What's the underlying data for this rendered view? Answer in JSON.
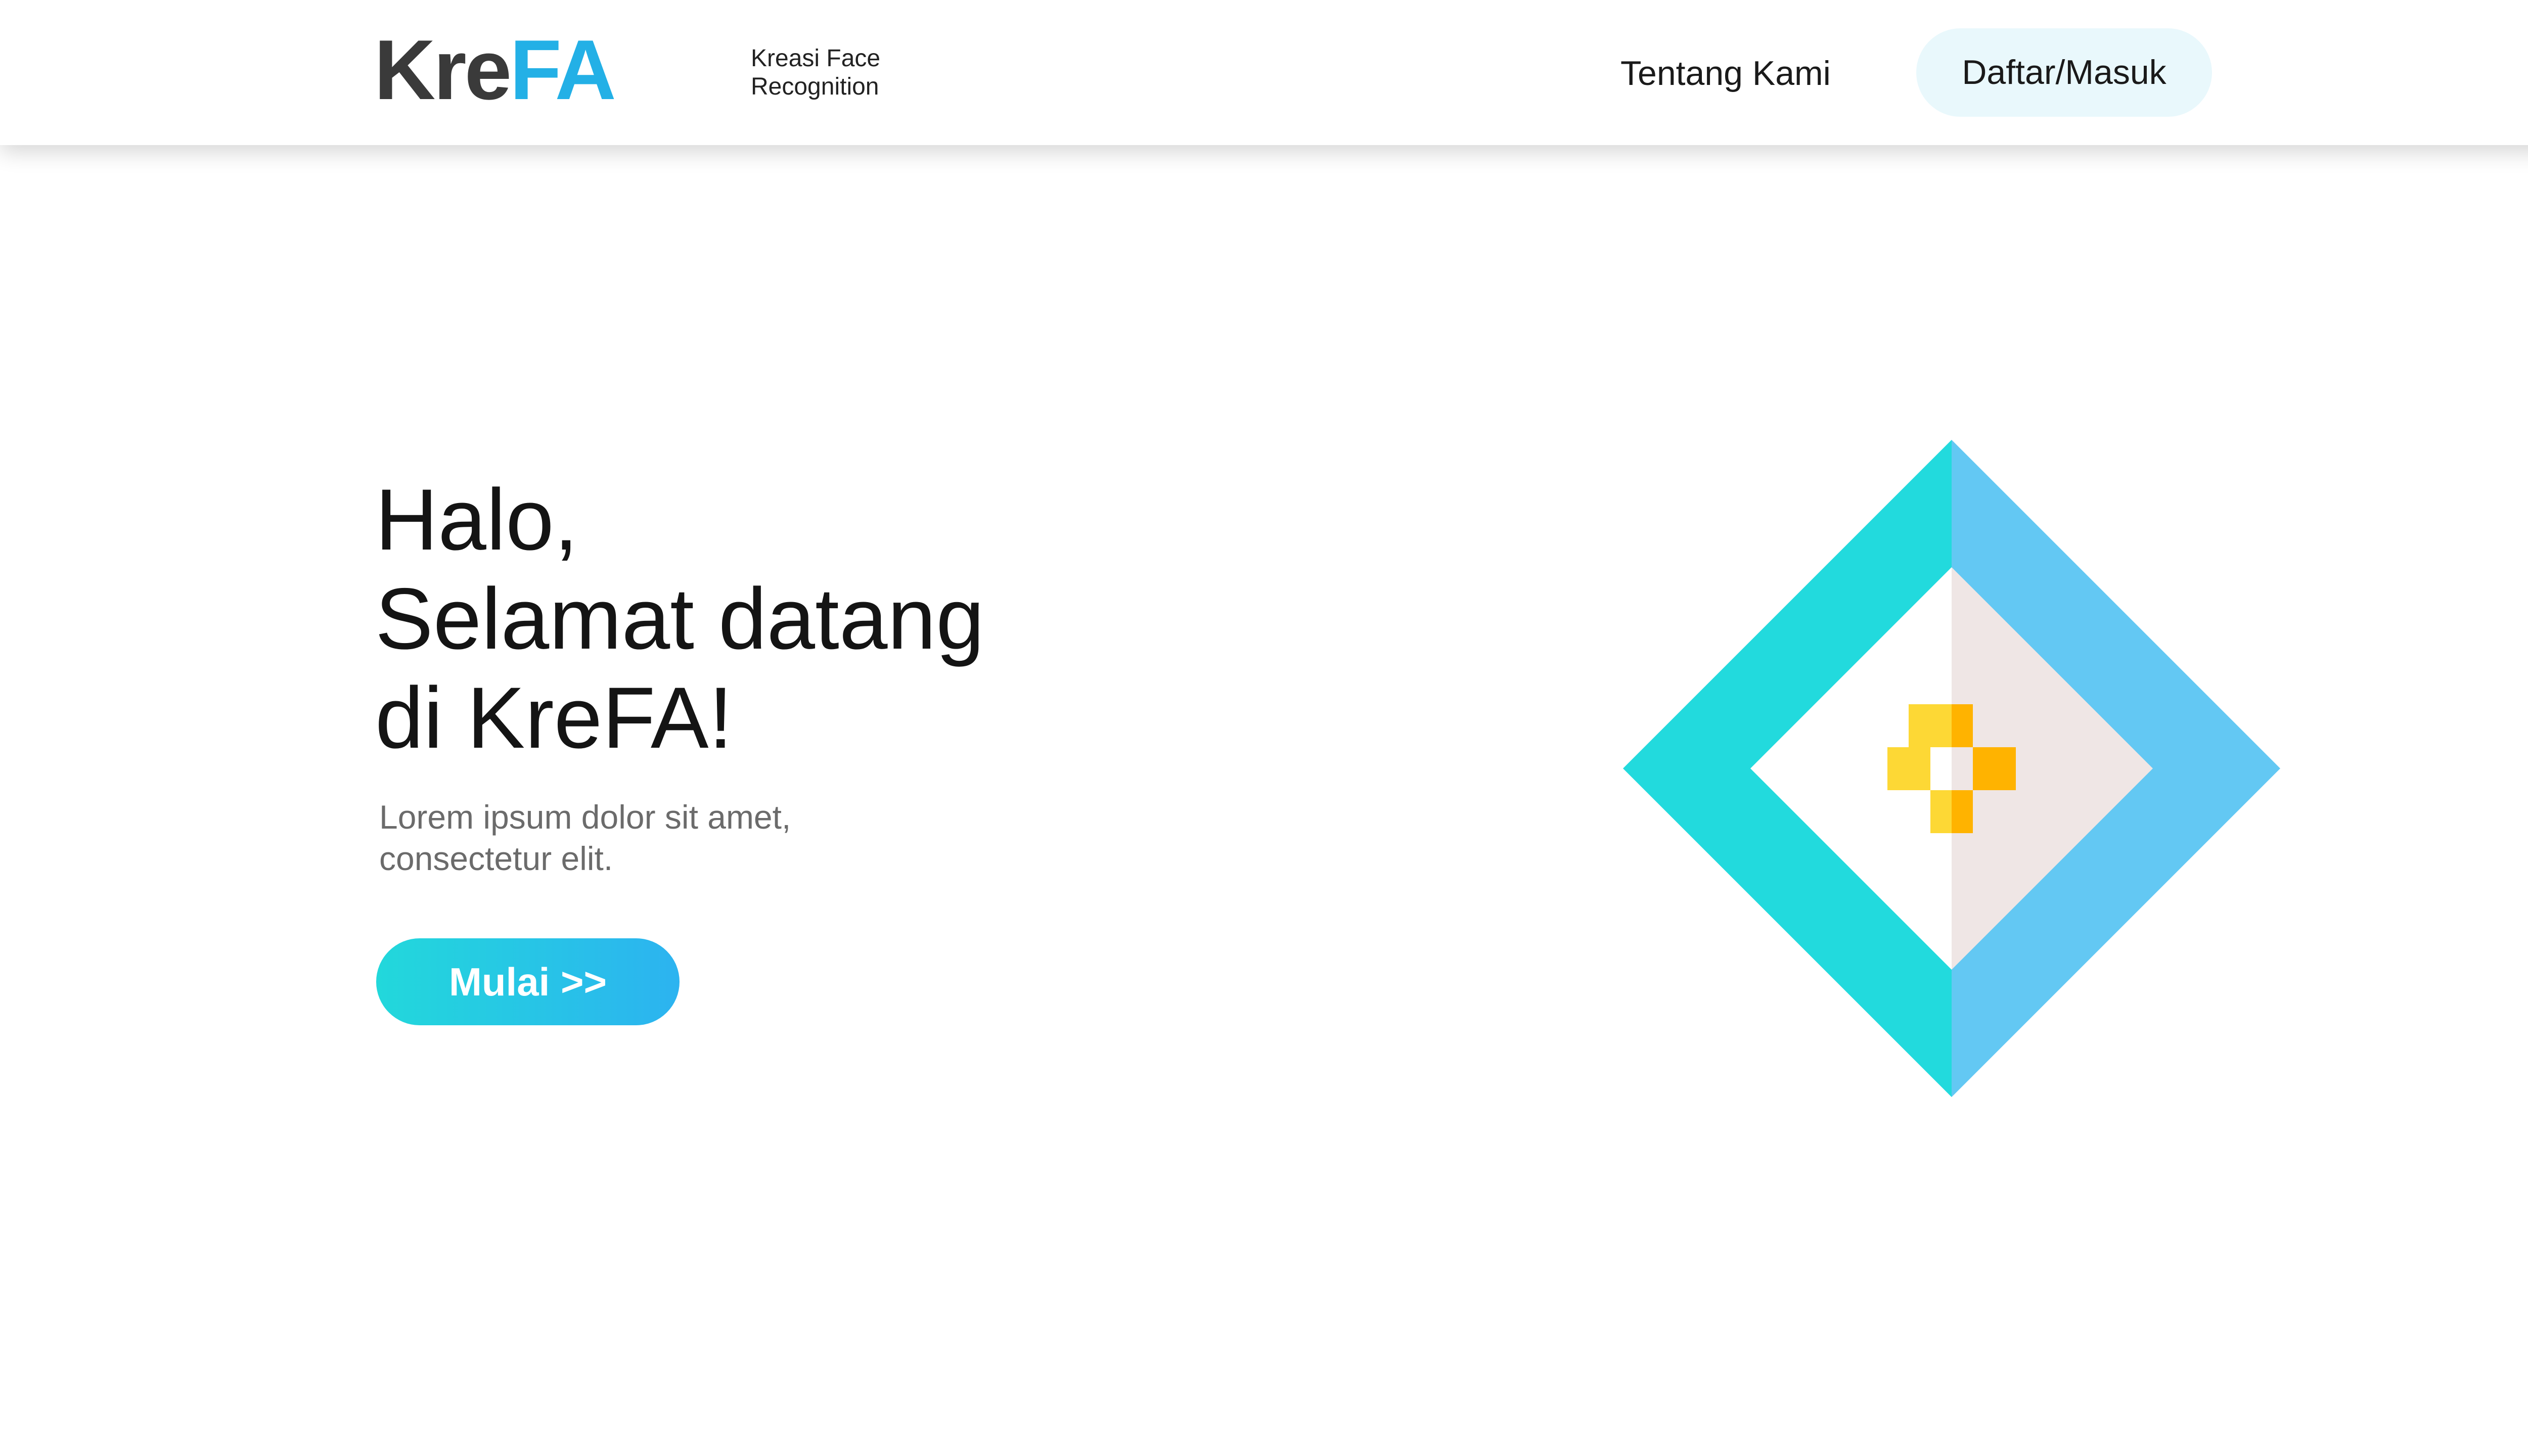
{
  "header": {
    "logo": {
      "part_dark": "Kre",
      "part_accent": "FA"
    },
    "tagline": "Kreasi Face\nRecognition",
    "nav_about": "Tentang Kami",
    "nav_auth": "Daftar/Masuk"
  },
  "hero": {
    "title_lines": [
      "Halo,",
      "Selamat datang",
      "di KreFA!"
    ],
    "subtitle_lines": [
      "Lorem ipsum dolor sit amet,",
      "consectetur elit."
    ],
    "cta_label": "Mulai >>"
  },
  "colors": {
    "brand_dark": "#3a3a3a",
    "brand_accent": "#23b0e6",
    "cta_gradient_start": "#22d8db",
    "cta_gradient_end": "#2cb3f0",
    "diamond_left": "#22dadd",
    "diamond_right": "#63c8f3",
    "center_left": "#ffffff",
    "center_right": "#efe6e5",
    "plus_yellow": "#fdd835",
    "plus_orange": "#ffb300",
    "auth_button_bg": "#e9f8fc"
  },
  "icons": {
    "illustration": "diamond-face-recognition-icon"
  }
}
